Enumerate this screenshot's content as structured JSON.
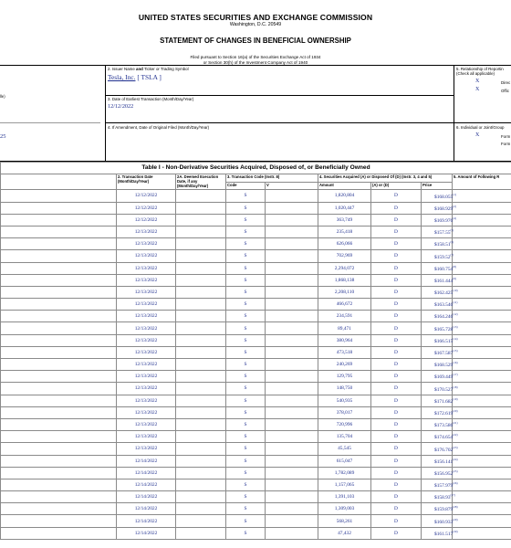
{
  "header": {
    "commission": "UNITED STATES SECURITIES AND EXCHANGE COMMISSION",
    "location": "Washington, D.C. 20549",
    "title": "STATEMENT OF CHANGES IN BENEFICIAL OWNERSHIP",
    "filed_line1": "Filed pursuant to Section 16(a) of the Securities Exchange Act of 1934",
    "filed_line2": "or Section 30(h) of the Investment Company Act of 1940"
  },
  "left_fragments": {
    "frag1": "lle)",
    "frag2": "25"
  },
  "issuer": {
    "label_pre": "2. Issuer Name ",
    "label_and": "and",
    "label_post": " Ticker or Trading Symbol",
    "name": "Tesla, Inc.",
    "ticker": "[ TSLA ]"
  },
  "earliest": {
    "label": "3. Date of Earliest Transaction (Month/Day/Year)",
    "value": "12/12/2022"
  },
  "amendment": {
    "label": "4. If Amendment, Date of Original Filed (Month/Day/Year)"
  },
  "relationship": {
    "label1": "5. Relationship of Reportin",
    "label2": "(Check all applicable)",
    "mark1": "X",
    "role1": "Direc",
    "mark2": "X",
    "role2": "Offic"
  },
  "individual": {
    "label": "6. Individual or Joint/Group",
    "mark": "X",
    "line1": "Form",
    "line2": "Form"
  },
  "table": {
    "title": "Table I - Non-Derivative Securities Acquired, Disposed of, or Beneficially Owned",
    "col_date": "2. Transaction Date (Month/Day/Year)",
    "col_deemed": "2A. Deemed Execution Date, if any (Month/Day/Year)",
    "col_code": "3. Transaction Code (Instr. 8)",
    "col_acq": "4. Securities Acquired (A) or Disposed Of (D) (Instr. 3, 4 and 5)",
    "col_amount5": "5. Amount of Following R",
    "sub_code": "Code",
    "sub_v": "V",
    "sub_amount": "Amount",
    "sub_ad": "(A) or (D)",
    "sub_price": "Price"
  },
  "rows": [
    {
      "date": "12/12/2022",
      "code": "S",
      "amount": "1,820,804",
      "ad": "D",
      "price": "$168.055",
      "fn": "(1)"
    },
    {
      "date": "12/12/2022",
      "code": "S",
      "amount": "1,020,447",
      "ad": "D",
      "price": "$168.929",
      "fn": "(2)"
    },
    {
      "date": "12/12/2022",
      "code": "S",
      "amount": "363,749",
      "ad": "D",
      "price": "$169.976",
      "fn": "(4)"
    },
    {
      "date": "12/13/2022",
      "code": "S",
      "amount": "235,418",
      "ad": "D",
      "price": "$157.55",
      "fn": "(5)"
    },
    {
      "date": "12/13/2022",
      "code": "S",
      "amount": "626,066",
      "ad": "D",
      "price": "$158.51",
      "fn": "(6)"
    },
    {
      "date": "12/13/2022",
      "code": "S",
      "amount": "702,969",
      "ad": "D",
      "price": "$159.52",
      "fn": "(7)"
    },
    {
      "date": "12/13/2022",
      "code": "S",
      "amount": "2,294,072",
      "ad": "D",
      "price": "$160.754",
      "fn": "(8)"
    },
    {
      "date": "12/13/2022",
      "code": "S",
      "amount": "1,868,138",
      "ad": "D",
      "price": "$161.444",
      "fn": "(9)"
    },
    {
      "date": "12/13/2022",
      "code": "S",
      "amount": "2,208,110",
      "ad": "D",
      "price": "$162.425",
      "fn": "(10)"
    },
    {
      "date": "12/13/2022",
      "code": "S",
      "amount": "466,672",
      "ad": "D",
      "price": "$163.546",
      "fn": "(11)"
    },
    {
      "date": "12/13/2022",
      "code": "S",
      "amount": "234,591",
      "ad": "D",
      "price": "$164.246",
      "fn": "(12)"
    },
    {
      "date": "12/13/2022",
      "code": "S",
      "amount": "89,471",
      "ad": "D",
      "price": "$165.728",
      "fn": "(13)"
    },
    {
      "date": "12/13/2022",
      "code": "S",
      "amount": "380,964",
      "ad": "D",
      "price": "$166.515",
      "fn": "(14)"
    },
    {
      "date": "12/13/2022",
      "code": "S",
      "amount": "473,518",
      "ad": "D",
      "price": "$167.587",
      "fn": "(15)"
    },
    {
      "date": "12/13/2022",
      "code": "S",
      "amount": "240,269",
      "ad": "D",
      "price": "$168.529",
      "fn": "(16)"
    },
    {
      "date": "12/13/2022",
      "code": "S",
      "amount": "129,795",
      "ad": "D",
      "price": "$169.449",
      "fn": "(17)"
    },
    {
      "date": "12/13/2022",
      "code": "S",
      "amount": "148,750",
      "ad": "D",
      "price": "$170.527",
      "fn": "(18)"
    },
    {
      "date": "12/13/2022",
      "code": "S",
      "amount": "540,935",
      "ad": "D",
      "price": "$171.682",
      "fn": "(19)"
    },
    {
      "date": "12/13/2022",
      "code": "S",
      "amount": "378,017",
      "ad": "D",
      "price": "$172.619",
      "fn": "(20)"
    },
    {
      "date": "12/13/2022",
      "code": "S",
      "amount": "720,996",
      "ad": "D",
      "price": "$173.586",
      "fn": "(21)"
    },
    {
      "date": "12/13/2022",
      "code": "S",
      "amount": "135,704",
      "ad": "D",
      "price": "$174.654",
      "fn": "(22)"
    },
    {
      "date": "12/13/2022",
      "code": "S",
      "amount": "45,545",
      "ad": "D",
      "price": "$176.702",
      "fn": "(23)"
    },
    {
      "date": "12/14/2022",
      "code": "S",
      "amount": "615,047",
      "ad": "D",
      "price": "$156.141",
      "fn": "(24)"
    },
    {
      "date": "12/14/2022",
      "code": "S",
      "amount": "1,782,089",
      "ad": "D",
      "price": "$156.952",
      "fn": "(25)"
    },
    {
      "date": "12/14/2022",
      "code": "S",
      "amount": "1,157,065",
      "ad": "D",
      "price": "$157.979",
      "fn": "(26)"
    },
    {
      "date": "12/14/2022",
      "code": "S",
      "amount": "1,391,103",
      "ad": "D",
      "price": "$158.93",
      "fn": "(27)"
    },
    {
      "date": "12/14/2022",
      "code": "S",
      "amount": "1,309,003",
      "ad": "D",
      "price": "$159.879",
      "fn": "(28)"
    },
    {
      "date": "12/14/2022",
      "code": "S",
      "amount": "568,261",
      "ad": "D",
      "price": "$160.933",
      "fn": "(29)"
    },
    {
      "date": "12/14/2022",
      "code": "S",
      "amount": "47,432",
      "ad": "D",
      "price": "$161.517",
      "fn": "(30)"
    }
  ]
}
